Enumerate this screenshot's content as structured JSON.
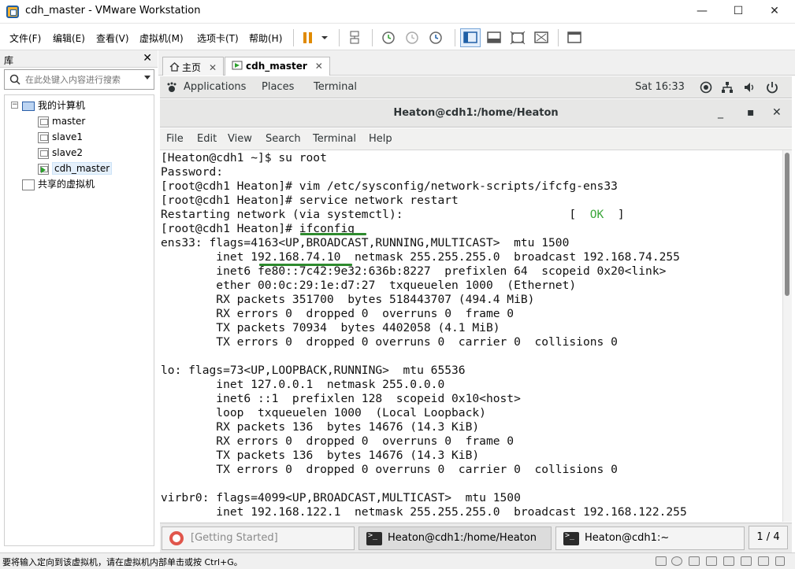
{
  "window": {
    "title": "cdh_master - VMware Workstation",
    "minimize": "—",
    "maximize": "☐",
    "close": "✕"
  },
  "menu": {
    "file": "文件(F)",
    "edit": "编辑(E)",
    "view": "查看(V)",
    "vm": "虚拟机(M)",
    "tabs": "选项卡(T)",
    "help": "帮助(H)"
  },
  "library": {
    "title": "库",
    "close": "✕",
    "search_placeholder": "在此处键入内容进行搜索",
    "root": "我的计算机",
    "vms": [
      "master",
      "slave1",
      "slave2",
      "cdh_master"
    ],
    "shared": "共享的虚拟机"
  },
  "tabs": {
    "home": "主页",
    "vm": "cdh_master",
    "close": "✕"
  },
  "guest_topbar": {
    "applications": "Applications",
    "places": "Places",
    "terminal": "Terminal",
    "clock": "Sat 16:33"
  },
  "terminal": {
    "title": "Heaton@cdh1:/home/Heaton",
    "controls": {
      "minimize": "_",
      "maximize": "▪",
      "close": "✕"
    },
    "menu": [
      "File",
      "Edit",
      "View",
      "Search",
      "Terminal",
      "Help"
    ],
    "lines_before_ok": "[Heaton@cdh1 ~]$ su root\nPassword:\n[root@cdh1 Heaton]# vim /etc/sysconfig/network-scripts/ifcfg-ens33\n[root@cdh1 Heaton]# service network restart\nRestarting network (via systemctl):                        [  ",
    "ok": "OK",
    "lines_after_ok": "  ]\n[root@cdh1 Heaton]# ifconfig\nens33: flags=4163<UP,BROADCAST,RUNNING,MULTICAST>  mtu 1500\n        inet 192.168.74.10  netmask 255.255.255.0  broadcast 192.168.74.255\n        inet6 fe80::7c42:9e32:636b:8227  prefixlen 64  scopeid 0x20<link>\n        ether 00:0c:29:1e:d7:27  txqueuelen 1000  (Ethernet)\n        RX packets 351700  bytes 518443707 (494.4 MiB)\n        RX errors 0  dropped 0  overruns 0  frame 0\n        TX packets 70934  bytes 4402058 (4.1 MiB)\n        TX errors 0  dropped 0 overruns 0  carrier 0  collisions 0\n\nlo: flags=73<UP,LOOPBACK,RUNNING>  mtu 65536\n        inet 127.0.0.1  netmask 255.0.0.0\n        inet6 ::1  prefixlen 128  scopeid 0x10<host>\n        loop  txqueuelen 1000  (Local Loopback)\n        RX packets 136  bytes 14676 (14.3 KiB)\n        RX errors 0  dropped 0  overruns 0  frame 0\n        TX packets 136  bytes 14676 (14.3 KiB)\n        TX errors 0  dropped 0 overruns 0  carrier 0  collisions 0\n\nvirbr0: flags=4099<UP,BROADCAST,MULTICAST>  mtu 1500\n        inet 192.168.122.1  netmask 255.255.255.0  broadcast 192.168.122.255"
  },
  "taskbar": {
    "items": [
      "[Getting Started]",
      "Heaton@cdh1:/home/Heaton",
      "Heaton@cdh1:~"
    ],
    "pager": "1 / 4"
  },
  "statusbar": {
    "message": "要将输入定向到该虚拟机，请在虚拟机内部单击或按 Ctrl+G。"
  },
  "colors": {
    "ok_green": "#3aa63a",
    "underline_green": "#2e8b2e",
    "accent_blue": "#1f5fa6"
  }
}
